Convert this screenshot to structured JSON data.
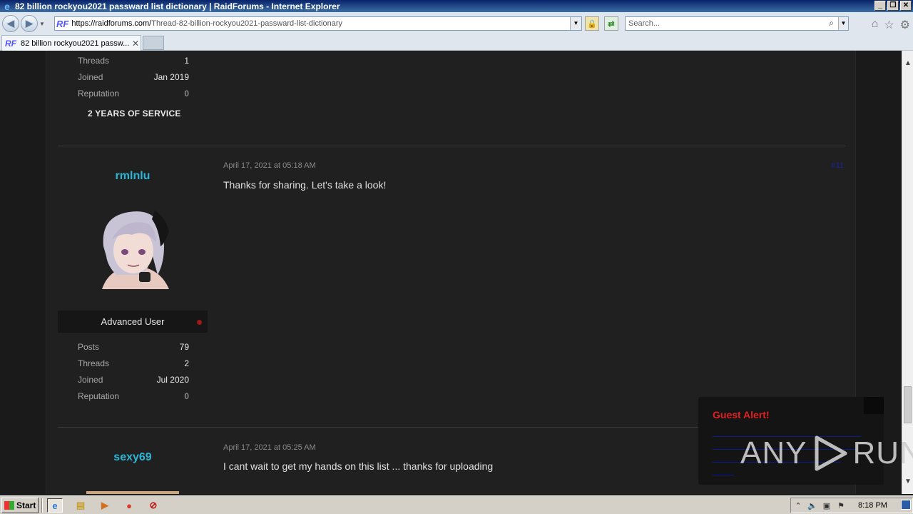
{
  "window": {
    "title": "82 billion rockyou2021 passward list dictionary | RaidForums - Internet Explorer",
    "controls": [
      "_",
      "❐",
      "✕"
    ]
  },
  "address_bar": {
    "site_badge": "RF",
    "url_domain": "https://raidforums.com/",
    "url_path": "Thread-82-billion-rockyou2021-passward-list-dictionary",
    "search_placeholder": "Search..."
  },
  "tabs": [
    {
      "badge": "RF",
      "label": "82 billion rockyou2021 passw..."
    }
  ],
  "prev_user": {
    "stats": [
      {
        "label": "Threads",
        "value": "1"
      },
      {
        "label": "Joined",
        "value": "Jan 2019"
      },
      {
        "label": "Reputation",
        "value": "0"
      }
    ],
    "service": "2 YEARS OF SERVICE"
  },
  "posts": [
    {
      "username": "rmlnlu",
      "date": "April 17, 2021 at 05:18 AM",
      "number": "#11",
      "body": "Thanks for sharing. Let's take a look!",
      "rank": "Advanced User",
      "stats": [
        {
          "label": "Posts",
          "value": "79"
        },
        {
          "label": "Threads",
          "value": "2"
        },
        {
          "label": "Joined",
          "value": "Jul 2020"
        },
        {
          "label": "Reputation",
          "value": "0"
        }
      ]
    },
    {
      "username": "sexy69",
      "date": "April 17, 2021 at 05:25 AM",
      "body": "I cant wait to get my hands on this list ... thanks for uploading"
    }
  ],
  "guest_alert": {
    "title": "Guest Alert!"
  },
  "watermark": {
    "left": "ANY",
    "right": "RUN"
  },
  "taskbar": {
    "start_label": "Start",
    "clock": "8:18 PM"
  },
  "colors": {
    "username": "#2bb6d8",
    "alert_title": "#e02020",
    "page_bg": "#1a1a1a",
    "container_bg": "#202020"
  }
}
